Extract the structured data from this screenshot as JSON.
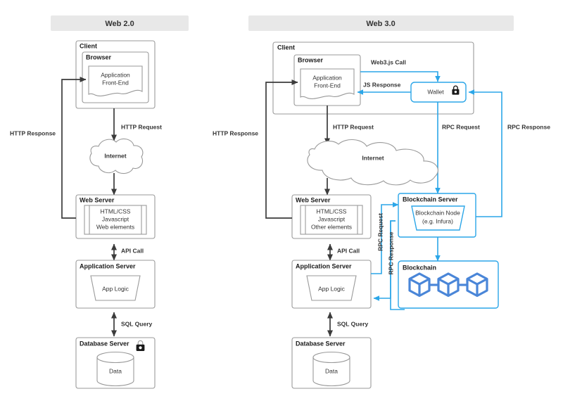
{
  "diagram": {
    "title_left": "Web 2.0",
    "title_right": "Web 3.0",
    "accent_blue": "#2BA6E8",
    "cube_blue": "#4a86d8",
    "gray_stroke": "#9a9a9a",
    "dark_arrow": "#3b3b3b",
    "header_bg": "#e8e8e8"
  },
  "web2": {
    "client": "Client",
    "browser": "Browser",
    "app_frontend_line1": "Application",
    "app_frontend_line2": "Front-End",
    "http_request": "HTTP Request",
    "http_response": "HTTP Response",
    "internet": "Internet",
    "web_server": "Web Server",
    "web_server_items": [
      "HTML/CSS",
      "Javascript",
      "Web elements"
    ],
    "api_call": "API Call",
    "application_server": "Application Server",
    "app_logic": "App Logic",
    "sql_query": "SQL Query",
    "database_server": "Database Server",
    "data": "Data",
    "lock_icon": "lock-icon"
  },
  "web3": {
    "client": "Client",
    "browser": "Browser",
    "app_frontend_line1": "Application",
    "app_frontend_line2": "Front-End",
    "web3js_call": "Web3.js Call",
    "js_response": "JS Response",
    "wallet": "Wallet",
    "wallet_lock_icon": "lock-icon",
    "http_request": "HTTP Request",
    "http_response": "HTTP Response",
    "rpc_request_top": "RPC Request",
    "rpc_response_top": "RPC Response",
    "internet": "Internet",
    "web_server": "Web Server",
    "web_server_items": [
      "HTML/CSS",
      "Javascript",
      "Other elements"
    ],
    "api_call": "API Call",
    "application_server": "Application Server",
    "app_logic": "App Logic",
    "sql_query": "SQL Query",
    "database_server": "Database Server",
    "data": "Data",
    "blockchain_server": "Blockchain Server",
    "blockchain_node_line1": "Blockchain Node",
    "blockchain_node_line2": "(e.g. Infura)",
    "blockchain": "Blockchain",
    "rpc_request_vertical": "RPC Request",
    "rpc_response_vertical": "RPC Response"
  }
}
